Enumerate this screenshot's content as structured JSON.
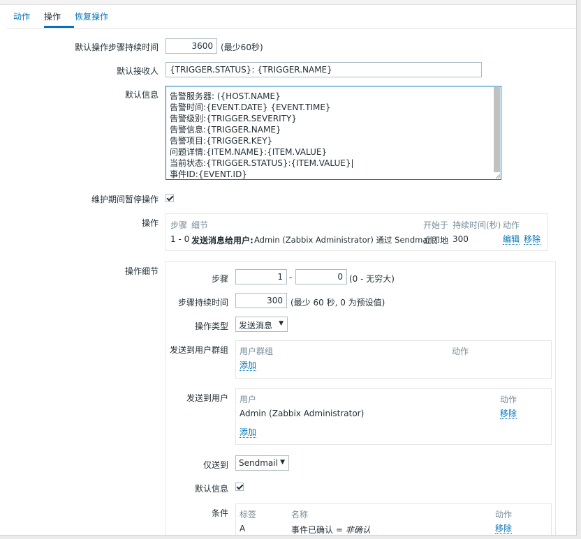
{
  "tabs": [
    {
      "label": "动作"
    },
    {
      "label": "操作"
    },
    {
      "label": "恢复操作"
    }
  ],
  "form": {
    "default_step_duration_label": "默认操作步骤持续时间",
    "default_step_duration_value": "3600",
    "default_step_duration_hint": "(最少60秒)",
    "default_subject_label": "默认接收人",
    "default_subject_value": "{TRIGGER.STATUS}: {TRIGGER.NAME}",
    "default_message_label": "默认信息",
    "default_message_lines": [
      "告警服务器: ({HOST.NAME}",
      "告警时间:{EVENT.DATE} {EVENT.TIME}",
      "告警级别:{TRIGGER.SEVERITY}",
      "告警信息:{TRIGGER.NAME}",
      "告警项目:{TRIGGER.KEY}",
      "问题详情:{ITEM.NAME}:{ITEM.VALUE}",
      "当前状态:{TRIGGER.STATUS}:{ITEM.VALUE}|",
      "事件ID:{EVENT.ID}"
    ],
    "pause_maintenance_label": "维护期间暂停操作",
    "operations_label": "操作",
    "operations_table": {
      "headers": {
        "steps": "步骤",
        "details": "细节",
        "start_in": "开始于",
        "duration": "持续时间(秒)",
        "action": "动作"
      },
      "row": {
        "steps": "1 - 0",
        "details_bold": "发送消息给用户:",
        "details_rest": "Admin (Zabbix Administrator) 通过 Sendmail",
        "start_in": "立即地",
        "duration": "300",
        "edit": "编辑",
        "remove": "移除"
      }
    },
    "operation_details_label": "操作细节"
  },
  "details": {
    "steps_label": "步骤",
    "step_from": "1",
    "step_dash": "-",
    "step_to": "0",
    "steps_hint": "(0 - 无穷大)",
    "step_duration_label": "步骤持续时间",
    "step_duration_value": "300",
    "step_duration_hint": "(最少 60 秒, 0 为预设值)",
    "operation_type_label": "操作类型",
    "operation_type_value": "发送消息",
    "send_to_groups_label": "发送到用户群组",
    "groups_header_group": "用户群组",
    "groups_header_action": "动作",
    "groups_add": "添加",
    "send_to_users_label": "发送到用户",
    "users_header_user": "用户",
    "users_header_action": "动作",
    "user_name": "Admin (Zabbix Administrator)",
    "user_remove": "移除",
    "users_add": "添加",
    "send_only_to_label": "仅送到",
    "send_only_to_value": "Sendmail",
    "default_message_label": "默认信息",
    "conditions_label": "条件",
    "conditions_header_label": "标签",
    "conditions_header_name": "名称",
    "conditions_header_action": "动作",
    "condition_label": "A",
    "condition_name_prefix": "事件已确认 = ",
    "condition_name_value": "非确认",
    "condition_remove": "移除"
  }
}
